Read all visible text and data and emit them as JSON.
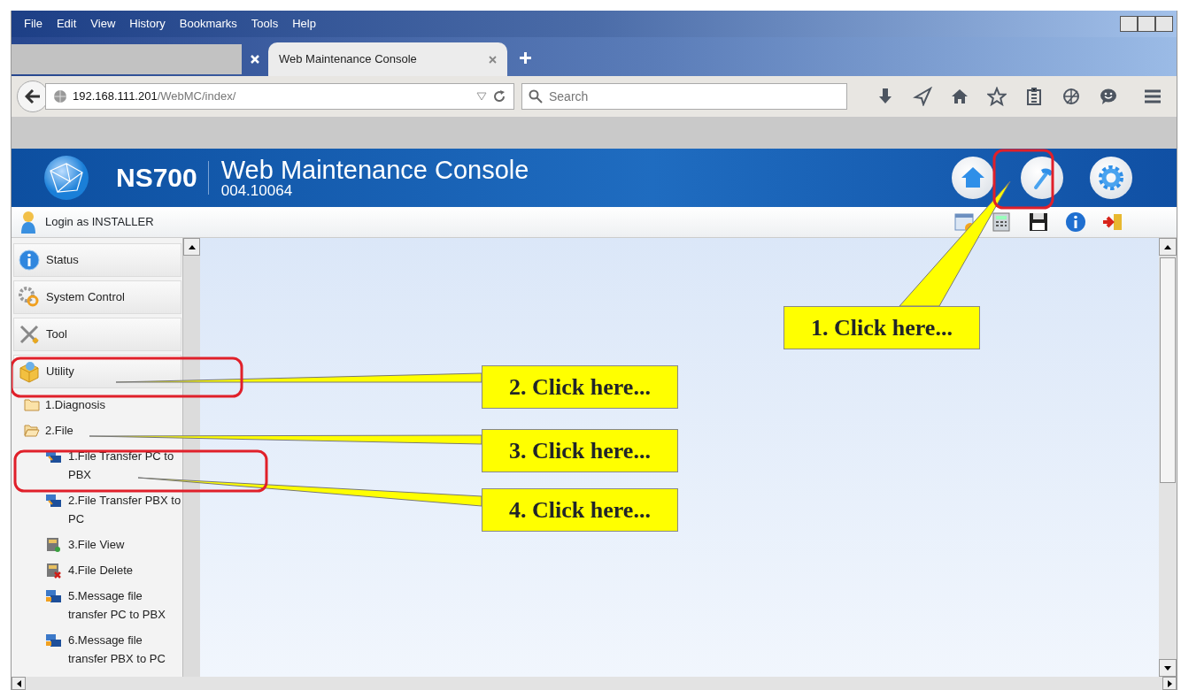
{
  "menu_bar": [
    "File",
    "Edit",
    "View",
    "History",
    "Bookmarks",
    "Tools",
    "Help"
  ],
  "tabs": [
    {
      "kind": "blank",
      "selected": false
    },
    {
      "kind": "page",
      "label": "Web Maintenance Console",
      "selected": true
    }
  ],
  "address_bar": {
    "host": "192.168.111.201",
    "path": "/WebMC/index/"
  },
  "search": {
    "placeholder": "Search"
  },
  "app": {
    "model": "NS700",
    "title": "Web Maintenance Console",
    "version": "004.10064",
    "header_buttons": [
      {
        "kind": "home"
      },
      {
        "kind": "tool"
      },
      {
        "kind": "settings"
      }
    ],
    "login": "Login as INSTALLER"
  },
  "sidebar": {
    "sections": [
      {
        "kind": "info",
        "label": "Status"
      },
      {
        "kind": "gears",
        "label": "System Control"
      },
      {
        "kind": "tools",
        "label": "Tool"
      },
      {
        "kind": "box",
        "label": "Utility",
        "children": [
          {
            "kind": "folder",
            "label": "1.Diagnosis",
            "expanded": false
          },
          {
            "kind": "folder",
            "label": "2.File",
            "expanded": true,
            "children": [
              {
                "kind": "transfer",
                "label": "1.File Transfer PC to PBX"
              },
              {
                "kind": "transfer",
                "label": "2.File Transfer PBX to PC"
              },
              {
                "kind": "view",
                "label": "3.File View"
              },
              {
                "kind": "delete",
                "label": "4.File Delete"
              },
              {
                "kind": "message",
                "label": "5.Message file transfer PC to PBX"
              },
              {
                "kind": "message",
                "label": "6.Message file transfer PBX to PC"
              }
            ]
          }
        ]
      }
    ]
  },
  "annotations": [
    {
      "label": "1. Click here..."
    },
    {
      "label": "2. Click here..."
    },
    {
      "label": "3. Click here..."
    },
    {
      "label": "4. Click here..."
    }
  ]
}
